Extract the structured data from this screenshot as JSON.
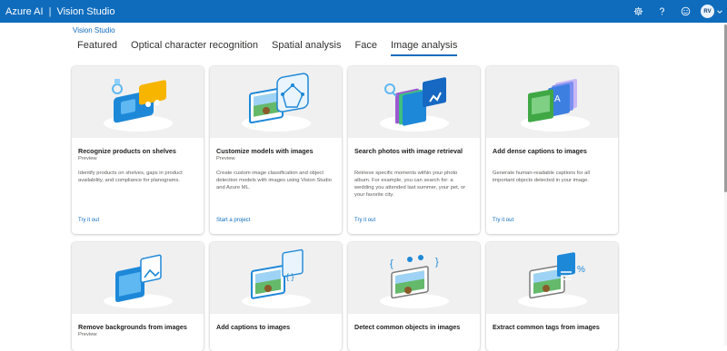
{
  "header": {
    "brand": "Azure AI",
    "separator": "|",
    "product": "Vision Studio",
    "avatar_initials": "RV",
    "icons": [
      "gear-icon",
      "help-icon",
      "smiley-icon",
      "chevron-down-icon"
    ]
  },
  "breadcrumb": "Vision Studio",
  "tabs": [
    {
      "label": "Featured",
      "active": false
    },
    {
      "label": "Optical character recognition",
      "active": false
    },
    {
      "label": "Spatial analysis",
      "active": false
    },
    {
      "label": "Face",
      "active": false
    },
    {
      "label": "Image analysis",
      "active": true
    }
  ],
  "cards": [
    {
      "title": "Recognize products on shelves",
      "badge": "Preview",
      "desc": "Identify products on shelves, gaps in product availability, and compliance for planograms.",
      "link": "Try it out",
      "illustration": "product-recognition-illustration"
    },
    {
      "title": "Customize models with images",
      "badge": "Preview",
      "desc": "Create custom image classification and object detection models with images using Vision Studio and Azure ML.",
      "link": "Start a project",
      "illustration": "custom-model-illustration"
    },
    {
      "title": "Search photos with image retrieval",
      "badge": "",
      "desc": "Retrieve specific moments within your photo album. For example, you can search for: a wedding you attended last summer, your pet, or your favorite city.",
      "link": "Try it out",
      "illustration": "image-retrieval-illustration"
    },
    {
      "title": "Add dense captions to images",
      "badge": "",
      "desc": "Generate human-readable captions for all important objects detected in your image.",
      "link": "Try it out",
      "illustration": "dense-captions-illustration"
    },
    {
      "title": "Remove backgrounds from images",
      "badge": "Preview",
      "desc": "",
      "link": "",
      "illustration": "background-removal-illustration"
    },
    {
      "title": "Add captions to images",
      "badge": "",
      "desc": "",
      "link": "",
      "illustration": "captions-illustration"
    },
    {
      "title": "Detect common objects in images",
      "badge": "",
      "desc": "",
      "link": "",
      "illustration": "object-detection-illustration"
    },
    {
      "title": "Extract common tags from images",
      "badge": "",
      "desc": "",
      "link": "",
      "illustration": "tags-illustration"
    }
  ],
  "colors": {
    "accent": "#0f6cbd",
    "card_image_bg": "#f0f0f0"
  }
}
